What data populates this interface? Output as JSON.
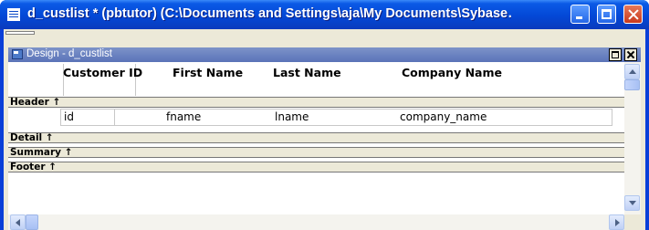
{
  "window": {
    "title": "d_custlist * (pbtutor) (C:\\Documents and Settings\\aja\\My Documents\\Sybase…",
    "icon": "app-window-icon",
    "controls": [
      "minimize-icon",
      "maximize-icon",
      "close-icon"
    ]
  },
  "painter": {
    "title": "Design - d_custlist",
    "icon": "datawindow-painter-icon",
    "controls": [
      "restore-icon",
      "close-icon"
    ]
  },
  "columns": {
    "customer_id": "Customer ID",
    "first_name": "First Name",
    "last_name": "Last Name",
    "company_name": "Company Name"
  },
  "bands": {
    "header": "Header ↑",
    "detail": "Detail ↑",
    "summary": "Summary ↑",
    "footer": "Footer ↑"
  },
  "fields": {
    "id": "id",
    "fname": "fname",
    "lname": "lname",
    "company_name": "company_name"
  },
  "colors": {
    "title_bar": "#0348d6",
    "mdi_title_bar": "#7d93c9",
    "band_bar": "#ece9d8",
    "close_button": "#c9391c"
  }
}
